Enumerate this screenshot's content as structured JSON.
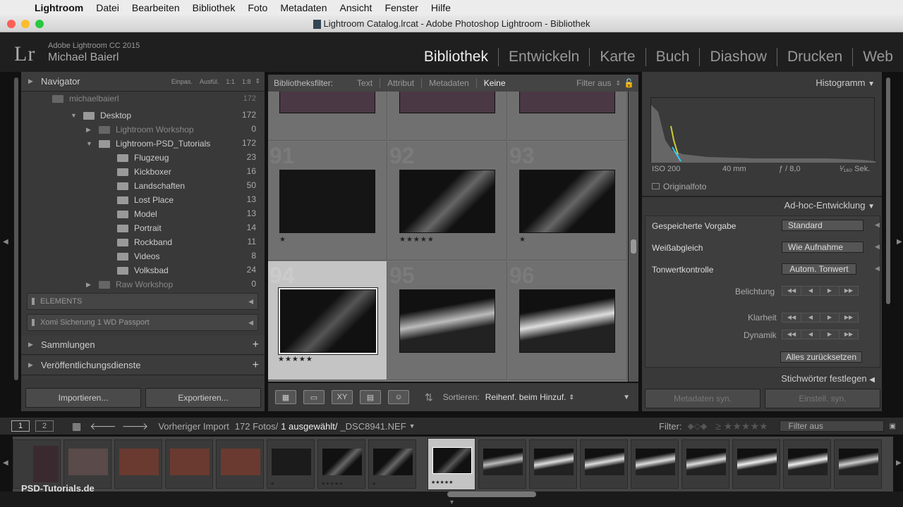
{
  "menubar": {
    "app": "Lightroom",
    "items": [
      "Datei",
      "Bearbeiten",
      "Bibliothek",
      "Foto",
      "Metadaten",
      "Ansicht",
      "Fenster",
      "Hilfe"
    ]
  },
  "window": {
    "title": "Lightroom Catalog.lrcat - Adobe Photoshop Lightroom - Bibliothek"
  },
  "identity": {
    "logo": "Lr",
    "product": "Adobe Lightroom CC 2015",
    "user": "Michael Baierl"
  },
  "modules": [
    "Bibliothek",
    "Entwickeln",
    "Karte",
    "Buch",
    "Diashow",
    "Drucken",
    "Web"
  ],
  "navigator": {
    "title": "Navigator",
    "zoom": [
      "Einpas.",
      "Ausfül.",
      "1:1",
      "1:8"
    ]
  },
  "folders": {
    "partial": {
      "label": "michaelbaierl",
      "count": "172"
    },
    "desktop": {
      "label": "Desktop",
      "count": "172"
    },
    "lr_workshop": {
      "label": "Lightroom Workshop",
      "count": "0"
    },
    "psd_tutorials": {
      "label": "Lightroom-PSD_Tutorials",
      "count": "172"
    },
    "sub": [
      {
        "label": "Flugzeug",
        "count": "23"
      },
      {
        "label": "Kickboxer",
        "count": "16"
      },
      {
        "label": "Landschaften",
        "count": "50"
      },
      {
        "label": "Lost Place",
        "count": "13"
      },
      {
        "label": "Model",
        "count": "13"
      },
      {
        "label": "Portrait",
        "count": "14"
      },
      {
        "label": "Rockband",
        "count": "11"
      },
      {
        "label": "Videos",
        "count": "8"
      },
      {
        "label": "Volksbad",
        "count": "24"
      }
    ],
    "raw": {
      "label": "Raw Workshop",
      "count": "0"
    }
  },
  "volumes": [
    "ELEMENTS",
    "Xomi Sicherung 1 WD Passport"
  ],
  "left_sections": {
    "collections": "Sammlungen",
    "publish": "Veröffentlichungsdienste"
  },
  "buttons": {
    "import": "Importieren...",
    "export": "Exportieren..."
  },
  "filterbar": {
    "label": "Bibliotheksfilter:",
    "options": [
      "Text",
      "Attribut",
      "Metadaten",
      "Keine"
    ],
    "filter_off": "Filter aus"
  },
  "grid": {
    "numbers": [
      "91",
      "92",
      "93",
      "94",
      "95",
      "96"
    ],
    "stars": [
      "★",
      "★★★★★",
      "★",
      "★★★★★"
    ]
  },
  "toolbar": {
    "sort_label": "Sortieren:",
    "sort_value": "Reihenf. beim Hinzuf."
  },
  "histogram": {
    "title": "Histogramm",
    "iso": "ISO 200",
    "focal": "40 mm",
    "aperture": "ƒ / 8,0",
    "shutter": "¹⁄₁₆₀ Sek.",
    "original": "Originalfoto"
  },
  "quick_develop": {
    "title": "Ad-hoc-Entwicklung",
    "preset_label": "Gespeicherte Vorgabe",
    "preset_value": "Standard",
    "wb_label": "Weißabgleich",
    "wb_value": "Wie Aufnahme",
    "tone_label": "Tonwertkontrolle",
    "auto_tone": "Autom. Tonwert",
    "exposure": "Belichtung",
    "clarity": "Klarheit",
    "vibrance": "Dynamik",
    "reset": "Alles zurücksetzen"
  },
  "keywording": {
    "title": "Stichwörter festlegen"
  },
  "sync": {
    "metadata": "Metadaten syn.",
    "settings": "Einstell. syn."
  },
  "filmstrip": {
    "page1": "1",
    "page2": "2",
    "source": "Vorheriger Import",
    "count": "172 Fotos/",
    "selected": "1 ausgewählt/",
    "filename": "_DSC8941.NEF",
    "filter_label": "Filter:",
    "filter_value": "Filter aus",
    "stars": [
      "★",
      "★★★★★",
      "★",
      "★★★★★"
    ]
  },
  "watermark": "PSD-Tutorials.de",
  "colors": {
    "accent": "#c4c4c4",
    "panel": "#393939"
  }
}
